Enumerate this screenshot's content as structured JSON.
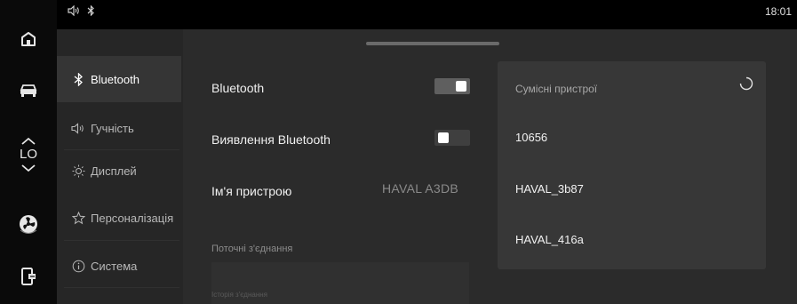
{
  "status": {
    "time": "18:01",
    "icons": [
      "speaker-icon",
      "bluetooth-icon"
    ]
  },
  "rail": {
    "items": [
      "home-icon",
      "car-icon",
      "chevron-up-icon",
      "temperature-text",
      "chevron-down-icon",
      "fan-icon",
      "phone-projection-icon"
    ],
    "temperature": "LO"
  },
  "menu": {
    "items": [
      {
        "label": "Bluetooth",
        "icon": "bluetooth-icon",
        "active": true
      },
      {
        "label": "Гучність",
        "icon": "speaker-icon",
        "active": false
      },
      {
        "label": "Дисплей",
        "icon": "sun-icon",
        "active": false
      },
      {
        "label": "Персоналізація",
        "icon": "star-icon",
        "active": false
      },
      {
        "label": "Система",
        "icon": "info-icon",
        "active": false
      }
    ]
  },
  "settings": {
    "bluetooth_label": "Bluetooth",
    "bluetooth_on": true,
    "discovery_label": "Виявлення Bluetooth",
    "discovery_on": false,
    "device_name_label": "Ім'я пристрою",
    "device_name_value": "HAVAL A3DB",
    "current_connection_label": "Поточні з'єднання",
    "history_label": "Історія з'єднання"
  },
  "devices": {
    "title": "Сумісні пристрої",
    "items": [
      "10656",
      "HAVAL_3b87",
      "HAVAL_416a"
    ]
  },
  "colors": {
    "background": "#000000",
    "panel": "#242424",
    "active_menu": "#353535",
    "device_card": "#373737"
  }
}
